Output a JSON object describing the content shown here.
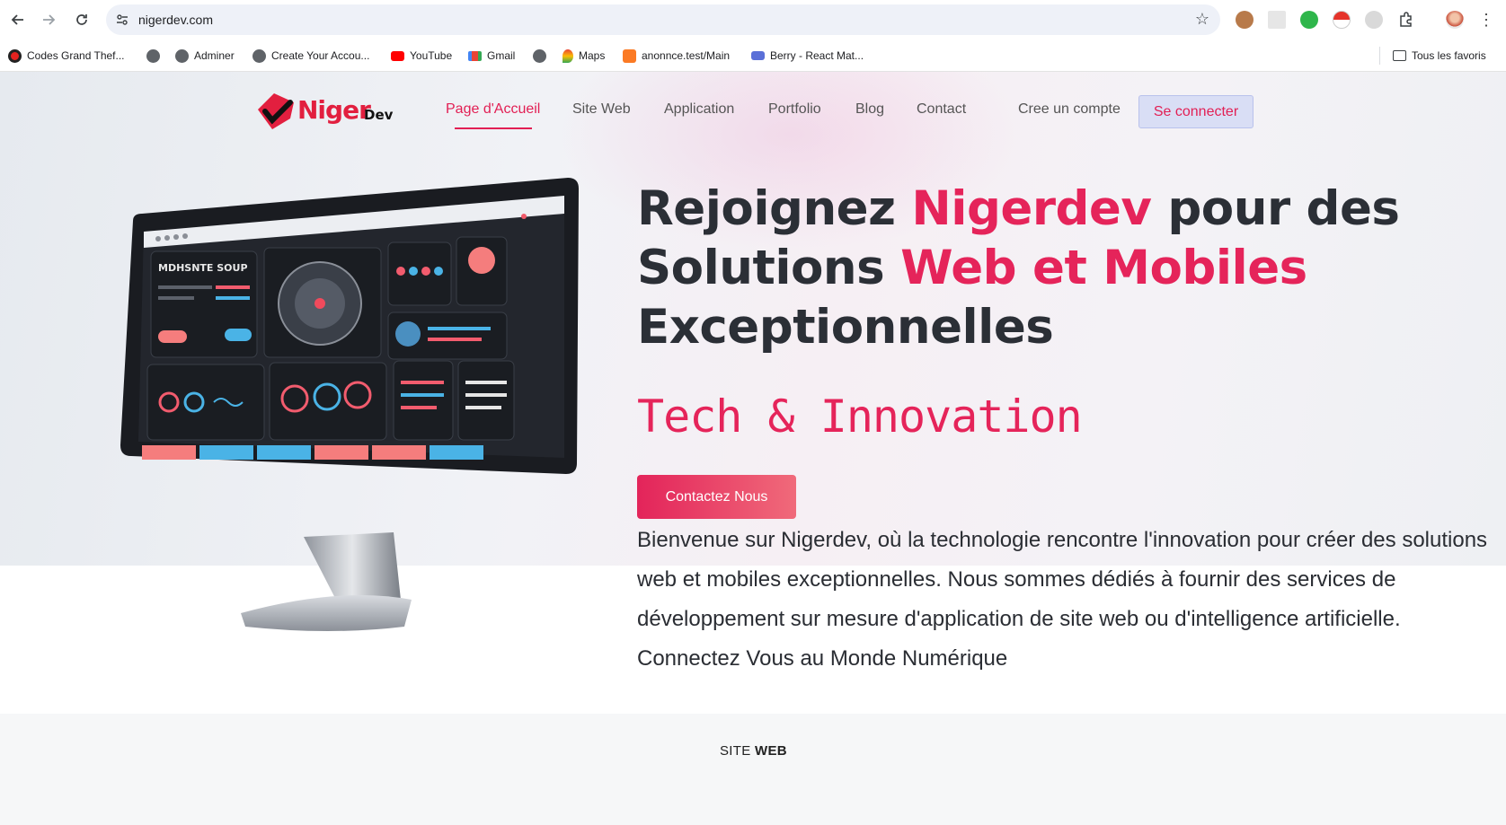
{
  "browser": {
    "url": "nigerdev.com",
    "bookmarks": [
      {
        "label": "Codes Grand Thef...",
        "icon": "red-circle-icon"
      },
      {
        "label": "",
        "icon": "globe-icon"
      },
      {
        "label": "Adminer",
        "icon": "globe-icon"
      },
      {
        "label": "Create Your Accou...",
        "icon": "globe-icon"
      },
      {
        "label": "YouTube",
        "icon": "youtube-icon"
      },
      {
        "label": "Gmail",
        "icon": "gmail-icon"
      },
      {
        "label": "",
        "icon": "globe-icon"
      },
      {
        "label": "Maps",
        "icon": "maps-icon"
      },
      {
        "label": "anonnce.test/Main",
        "icon": "xampp-icon"
      },
      {
        "label": "Berry - React Mat...",
        "icon": "berry-icon"
      }
    ],
    "all_bookmarks_label": "Tous les favoris"
  },
  "site": {
    "logo_text": "Niger",
    "logo_sub": "Dev",
    "nav": [
      {
        "label": "Page d'Accueil",
        "active": true
      },
      {
        "label": "Site Web"
      },
      {
        "label": "Application"
      },
      {
        "label": "Portfolio"
      },
      {
        "label": "Blog"
      },
      {
        "label": "Contact"
      }
    ],
    "register_label": "Cree un compte",
    "login_label": "Se connecter"
  },
  "hero": {
    "headline_1": "Rejoignez ",
    "headline_accent_1": "Nigerdev",
    "headline_2": " pour des Solutions ",
    "headline_accent_2": "Web et Mobiles",
    "headline_3": " Exceptionnelles",
    "tagline": "Tech & Innovation",
    "cta_label": "Contactez Nous",
    "intro": "Bienvenue sur Nigerdev, où la technologie rencontre l'innovation pour créer des solutions web et mobiles exceptionnelles. Nous sommes dédiés à fournir des services de développement sur mesure d'application de site web ou d'intelligence artificielle. Connectez Vous au Monde Numérique",
    "monitor_screen_title": "MDHSNTE SOUP"
  },
  "section": {
    "label_light": "SITE ",
    "label_bold": "WEB"
  },
  "colors": {
    "accent": "#e5245a",
    "heading": "#2b2f36",
    "login_bg": "#d9def5"
  }
}
